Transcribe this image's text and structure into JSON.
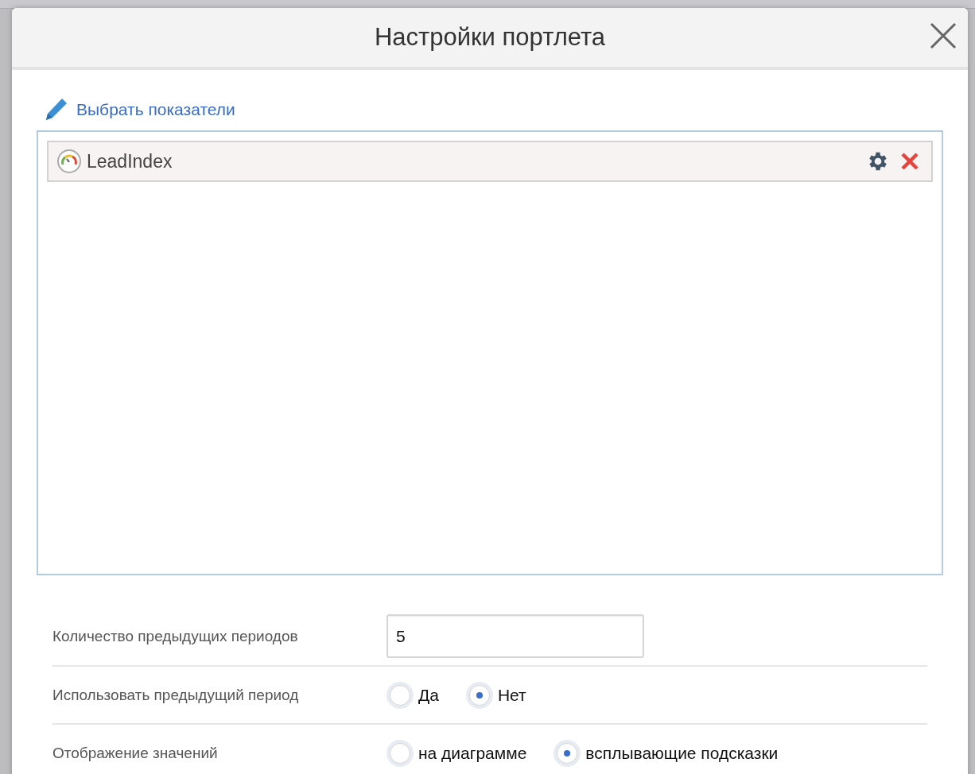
{
  "dialog": {
    "title": "Настройки портлета"
  },
  "select_link": "Выбрать показатели",
  "indicators": [
    {
      "name": "LeadIndex"
    }
  ],
  "settings": [
    {
      "kind": "text",
      "label": "Количество предыдущих периодов",
      "value": "5"
    },
    {
      "kind": "radio",
      "label": "Использовать предыдущий период",
      "options": [
        {
          "label": "Да",
          "selected": false
        },
        {
          "label": "Нет",
          "selected": true
        }
      ]
    },
    {
      "kind": "radio",
      "label": "Отображение значений",
      "options": [
        {
          "label": "на диаграмме",
          "selected": false
        },
        {
          "label": "всплывающие подсказки",
          "selected": true
        }
      ]
    }
  ]
}
